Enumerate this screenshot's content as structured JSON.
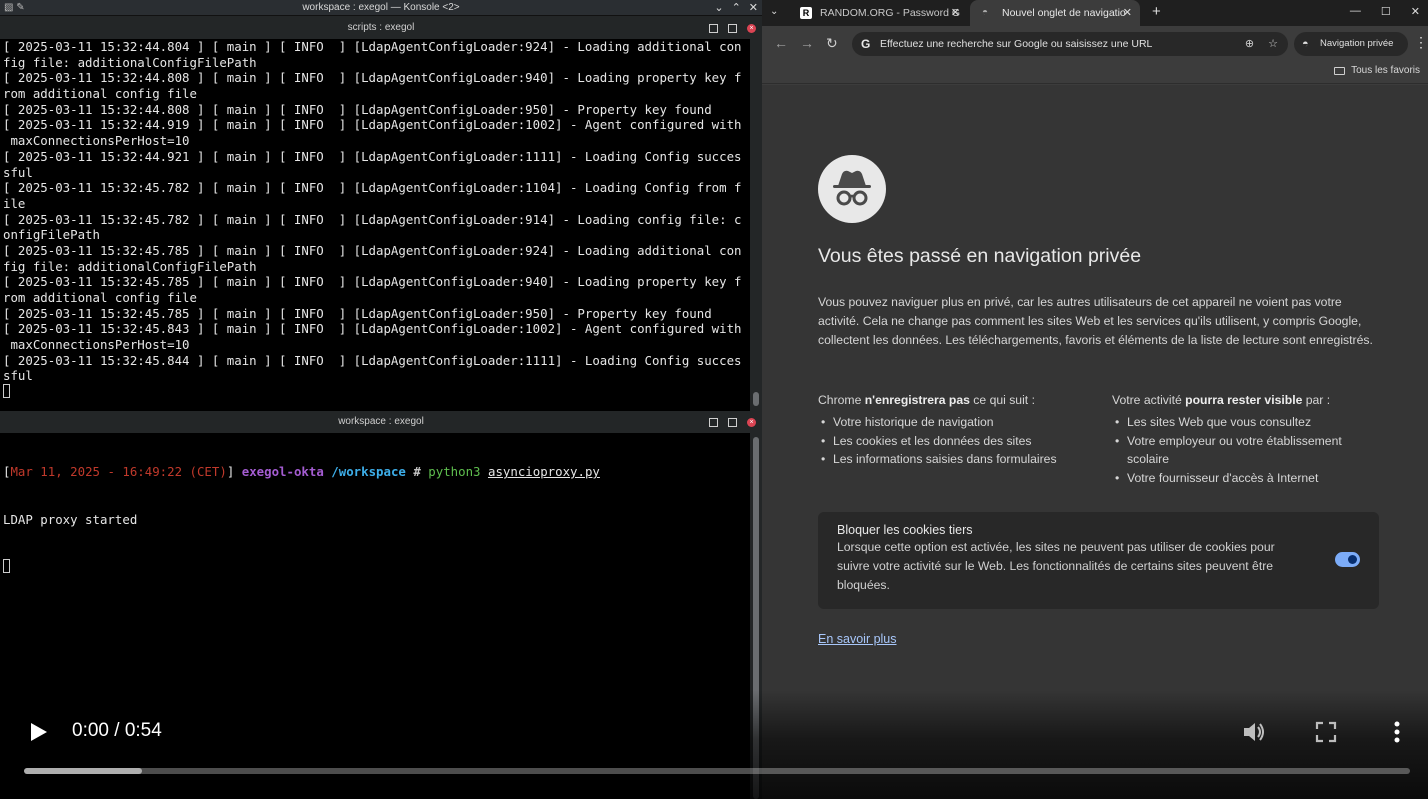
{
  "konsole": {
    "window_title": "workspace : exegol — Konsole <2>",
    "pane_top_title": "scripts : exegol",
    "pane_bottom_title": "workspace : exegol",
    "log_lines": [
      "[ 2025-03-11 15:32:44.804 ] [ main ] [ INFO  ] [LdapAgentConfigLoader:924] - Loading additional con",
      "fig file: additionalConfigFilePath",
      "[ 2025-03-11 15:32:44.808 ] [ main ] [ INFO  ] [LdapAgentConfigLoader:940] - Loading property key f",
      "rom additional config file",
      "[ 2025-03-11 15:32:44.808 ] [ main ] [ INFO  ] [LdapAgentConfigLoader:950] - Property key found",
      "[ 2025-03-11 15:32:44.919 ] [ main ] [ INFO  ] [LdapAgentConfigLoader:1002] - Agent configured with",
      " maxConnectionsPerHost=10",
      "[ 2025-03-11 15:32:44.921 ] [ main ] [ INFO  ] [LdapAgentConfigLoader:1111] - Loading Config succes",
      "sful",
      "[ 2025-03-11 15:32:45.782 ] [ main ] [ INFO  ] [LdapAgentConfigLoader:1104] - Loading Config from f",
      "ile",
      "[ 2025-03-11 15:32:45.782 ] [ main ] [ INFO  ] [LdapAgentConfigLoader:914] - Loading config file: c",
      "onfigFilePath",
      "[ 2025-03-11 15:32:45.785 ] [ main ] [ INFO  ] [LdapAgentConfigLoader:924] - Loading additional con",
      "fig file: additionalConfigFilePath",
      "[ 2025-03-11 15:32:45.785 ] [ main ] [ INFO  ] [LdapAgentConfigLoader:940] - Loading property key f",
      "rom additional config file",
      "[ 2025-03-11 15:32:45.785 ] [ main ] [ INFO  ] [LdapAgentConfigLoader:950] - Property key found",
      "[ 2025-03-11 15:32:45.843 ] [ main ] [ INFO  ] [LdapAgentConfigLoader:1002] - Agent configured with",
      " maxConnectionsPerHost=10",
      "[ 2025-03-11 15:32:45.844 ] [ main ] [ INFO  ] [LdapAgentConfigLoader:1111] - Loading Config succes",
      "sful"
    ],
    "prompt": {
      "open_bracket": "[",
      "timestamp": "Mar 11, 2025 - 16:49:22 (CET)",
      "close_bracket": "]",
      "host": "exegol-okta",
      "path": "/workspace",
      "hash": "#",
      "command": "python3",
      "argument": "asyncioproxy.py"
    },
    "output_line": "LDAP proxy started"
  },
  "chrome": {
    "tabs": [
      {
        "label": "RANDOM.ORG - Password G",
        "favicon": "R"
      },
      {
        "label": "Nouvel onglet de navigatio",
        "favicon": "incognito-icon"
      }
    ],
    "omnibox_placeholder": "Effectuez une recherche sur Google ou saisissez une URL",
    "omnibox_g": "G",
    "incognito_label": "Navigation privée",
    "bookmarks_all": "Tous les favoris",
    "page": {
      "heading": "Vous êtes passé en navigation privée",
      "paragraph": "Vous pouvez naviguer plus en privé, car les autres utilisateurs de cet appareil ne voient pas votre activité. Cela ne change pas comment les sites Web et les services qu'ils utilisent, y compris Google, collectent les données. Les téléchargements, favoris et éléments de la liste de lecture sont enregistrés.",
      "left_heading_prefix": "Chrome ",
      "left_heading_bold": "n'enregistrera pas",
      "left_heading_suffix": " ce qui suit :",
      "left_items": [
        "Votre historique de navigation",
        "Les cookies et les données des sites",
        "Les informations saisies dans formulaires"
      ],
      "right_heading_prefix": "Votre activité ",
      "right_heading_bold": "pourra rester visible",
      "right_heading_suffix": " par :",
      "right_items": [
        "Les sites Web que vous consultez",
        "Votre employeur ou votre établissement scolaire",
        "Votre fournisseur d'accès à Internet"
      ],
      "cookie_title": "Bloquer les cookies tiers",
      "cookie_desc": "Lorsque cette option est activée, les sites ne peuvent pas utiliser de cookies pour suivre votre activité sur le Web. Les fonctionnalités de certains sites peuvent être bloquées.",
      "cookie_toggle_on": true,
      "learn_more": "En savoir plus"
    }
  },
  "video": {
    "time_display": "0:00 / 0:54",
    "buffered_fraction": 0.085,
    "played_fraction": 0
  }
}
